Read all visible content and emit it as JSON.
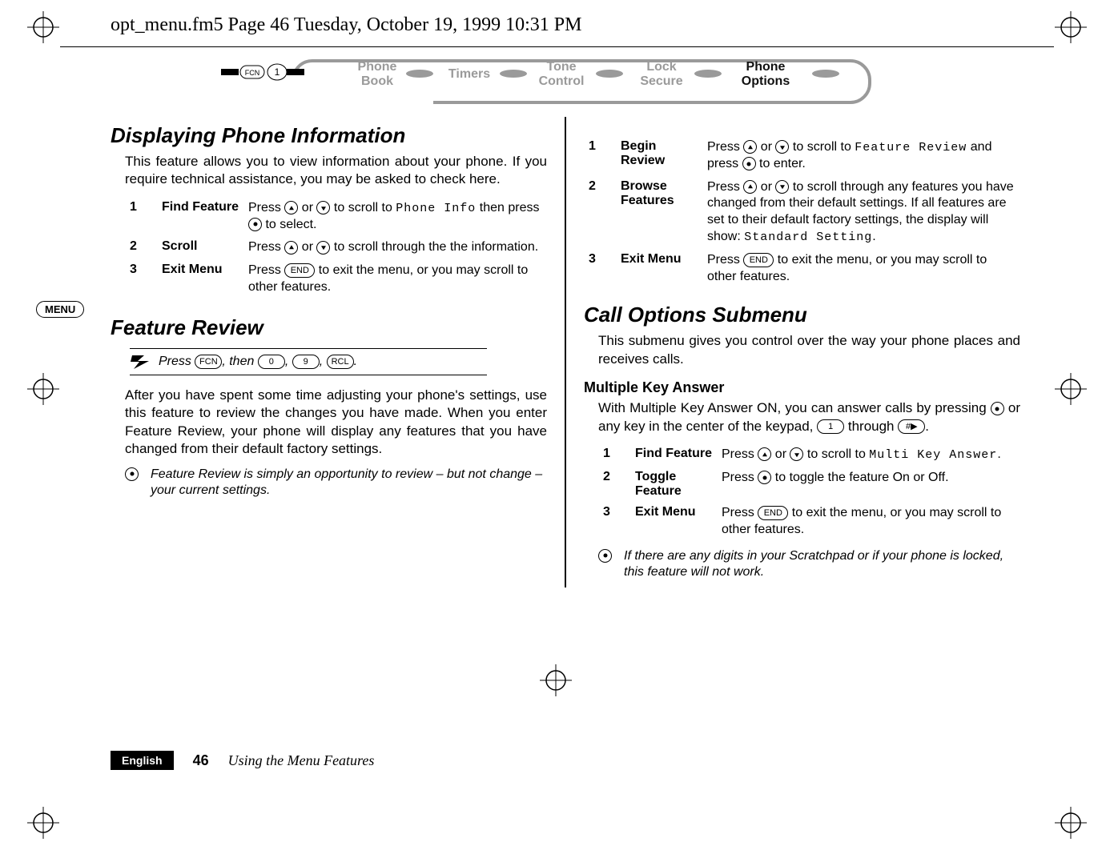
{
  "header": {
    "running": "opt_menu.fm5  Page 46  Tuesday, October 19, 1999  10:31 PM"
  },
  "nav": {
    "leading_keys": [
      "FCN",
      "1"
    ],
    "items": [
      {
        "l1": "Phone",
        "l2": "Book",
        "active": false
      },
      {
        "l1": "Timers",
        "l2": "",
        "active": false
      },
      {
        "l1": "Tone",
        "l2": "Control",
        "active": false
      },
      {
        "l1": "Lock",
        "l2": "Secure",
        "active": false
      },
      {
        "l1": "Phone",
        "l2": "Options",
        "active": true
      }
    ]
  },
  "left": {
    "h_display": "Displaying Phone Information",
    "p_display": "This feature allows you to view information about your phone. If you require technical assistance, you may be asked to check here.",
    "steps_display": [
      {
        "title": "Find Feature",
        "desc_pre": "Press ",
        "desc_mid": " or ",
        "desc_post1": " to scroll to ",
        "lcd": "Phone Info",
        "desc_post2": " then press ",
        "desc_end": " to select."
      },
      {
        "title": "Scroll",
        "desc_pre": "Press ",
        "desc_mid": " or ",
        "desc_post": " to scroll through the the information."
      },
      {
        "title": "Exit Menu",
        "desc_pre": "Press ",
        "desc_post": " to exit the menu, or you may scroll to other features."
      }
    ],
    "h_review": "Feature Review",
    "shortcut": {
      "pre": "Press ",
      "keys": [
        "FCN",
        "0",
        "9",
        "RCL"
      ],
      "sep": ", ",
      "then": ", then ",
      "end": "."
    },
    "p_review": "After you have spent some time adjusting your phone's settings, use this feature to review the changes you have made. When you enter Feature Review, your phone will display any features that you have changed from their default factory settings.",
    "note_review": "Feature Review is simply an opportunity to review – but not change – your current settings."
  },
  "right": {
    "steps_review": [
      {
        "title": "Begin Review",
        "desc_pre": "Press ",
        "desc_mid": " or ",
        "desc_post1": " to scroll to ",
        "lcd": "Feature Review",
        "desc_post2": " and press ",
        "desc_end": " to enter."
      },
      {
        "title": "Browse Features",
        "desc_pre": "Press ",
        "desc_mid": " or ",
        "desc_post": " to scroll through any features you have changed from their default settings. If all features are set to their default factory settings, the display will show: ",
        "lcd": "Standard Setting",
        "desc_end": "."
      },
      {
        "title": "Exit Menu",
        "desc_pre": "Press ",
        "desc_post": " to exit the menu, or you may scroll to other features."
      }
    ],
    "h_call": "Call Options Submenu",
    "p_call": "This submenu gives you control over the way your phone places and receives calls.",
    "h_mka": "Multiple Key Answer",
    "p_mka_pre": "With Multiple Key Answer ON, you can answer calls by pressing ",
    "p_mka_mid": " or any key in the center of the keypad, ",
    "p_mka_through": " through ",
    "p_mka_keys": [
      "1",
      "#▶"
    ],
    "p_mka_end": ".",
    "steps_mka": [
      {
        "title": "Find Feature",
        "desc_pre": "Press ",
        "desc_mid": " or ",
        "desc_post1": " to scroll to ",
        "lcd": "Multi Key Answer",
        "desc_end": "."
      },
      {
        "title": "Toggle Feature",
        "desc_pre": "Press ",
        "desc_post": " to toggle the feature On or Off."
      },
      {
        "title": "Exit Menu",
        "desc_pre": "Press ",
        "desc_post": " to exit the menu, or you may scroll to other features."
      }
    ],
    "note_mka": "If there are any digits in your Scratchpad or if your phone is locked, this feature will not work."
  },
  "menu_badge": "MENU",
  "footer": {
    "lang": "English",
    "pagenum": "46",
    "title": "Using the Menu Features"
  },
  "keys": {
    "end": "END"
  }
}
